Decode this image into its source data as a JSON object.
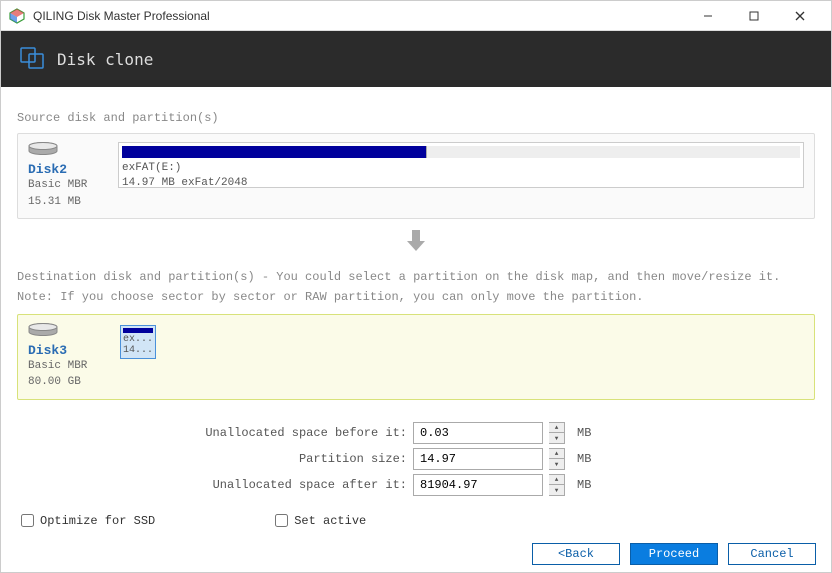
{
  "window": {
    "title": "QILING Disk Master Professional"
  },
  "header": {
    "title": "Disk clone"
  },
  "source": {
    "label": "Source disk and partition(s)",
    "disk": {
      "name": "Disk2",
      "type": "Basic MBR",
      "size": "15.31 MB"
    },
    "partition": {
      "label": "exFAT(E:)",
      "detail": "14.97 MB exFat/2048",
      "fill_percent": 45
    }
  },
  "dest": {
    "label": "Destination disk and partition(s) - You could select a partition on the disk map, and then move/resize it.",
    "note": "Note: If you choose sector by sector or RAW partition, you can only move the partition.",
    "disk": {
      "name": "Disk3",
      "type": "Basic MBR",
      "size": "80.00 GB"
    },
    "partition": {
      "label1": "ex...",
      "label2": "14..."
    }
  },
  "form": {
    "before": {
      "label": "Unallocated space before it:",
      "value": "0.03",
      "unit": "MB"
    },
    "size": {
      "label": "Partition size:",
      "value": "14.97",
      "unit": "MB"
    },
    "after": {
      "label": "Unallocated space after it:",
      "value": "81904.97",
      "unit": "MB"
    }
  },
  "checks": {
    "ssd": "Optimize for SSD",
    "active": "Set active"
  },
  "buttons": {
    "back": "<Back",
    "proceed": "Proceed",
    "cancel": "Cancel"
  }
}
